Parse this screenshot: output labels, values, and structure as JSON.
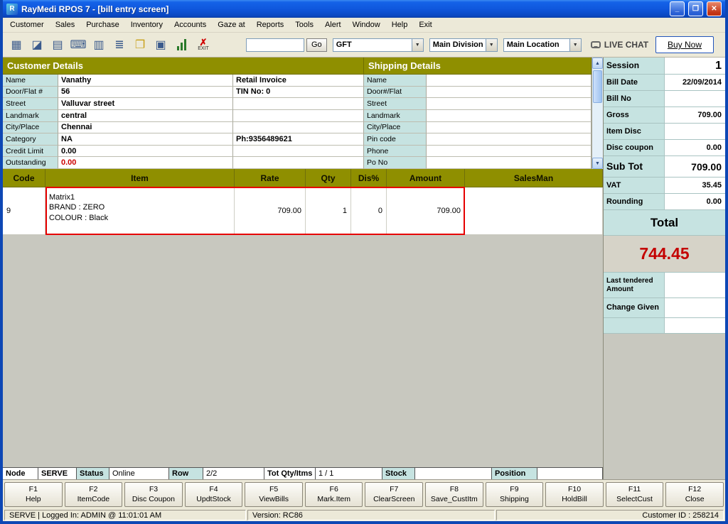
{
  "window": {
    "title": "RayMedi RPOS 7 - [bill entry screen]",
    "app_icon_letter": "R",
    "controls": {
      "minimize": "_",
      "maximize": "❐",
      "close": "✕"
    }
  },
  "menu": {
    "items": [
      "Customer",
      "Sales",
      "Purchase",
      "Inventory",
      "Accounts",
      "Gaze at",
      "Reports",
      "Tools",
      "Alert",
      "Window",
      "Help",
      "Exit"
    ]
  },
  "toolbar": {
    "icons": [
      {
        "name": "bill-icon",
        "glyph": "▦"
      },
      {
        "name": "save-icon",
        "glyph": "◪"
      },
      {
        "name": "print-icon",
        "glyph": "▤"
      },
      {
        "name": "keypad-icon",
        "glyph": "⌨"
      },
      {
        "name": "notes-icon",
        "glyph": "▥"
      },
      {
        "name": "document-icon",
        "glyph": "≣"
      },
      {
        "name": "folder-open-icon",
        "glyph": "❐"
      },
      {
        "name": "display-icon",
        "glyph": "▣"
      }
    ],
    "exit_icon_glyph": "✗",
    "exit_label": "EXIT",
    "search_value": "",
    "go_label": "Go",
    "product_combo_value": "GFT",
    "division_combo_value": "Main Division",
    "location_combo_value": "Main Location",
    "live_chat_label": "LIVE CHAT",
    "buy_now_label": "Buy Now",
    "dropdown_arrow": "▼"
  },
  "customer": {
    "header": "Customer Details",
    "rows": [
      {
        "label": "Name",
        "value": "Vanathy",
        "extra": "Retail Invoice"
      },
      {
        "label": "Door/Flat #",
        "value": "56",
        "extra": "TIN No: 0"
      },
      {
        "label": "Street",
        "value": "Valluvar street",
        "extra": ""
      },
      {
        "label": "Landmark",
        "value": "central",
        "extra": ""
      },
      {
        "label": "City/Place",
        "value": "Chennai",
        "extra": ""
      },
      {
        "label": "Category",
        "value": "NA",
        "extra": "Ph:9356489621"
      },
      {
        "label": "Credit Limit",
        "value": "0.00",
        "extra": ""
      },
      {
        "label": "Outstanding",
        "value": "0.00",
        "extra": ""
      }
    ]
  },
  "shipping": {
    "header": "Shipping Details",
    "rows": [
      {
        "label": "Name",
        "value": ""
      },
      {
        "label": "Door#/Flat",
        "value": ""
      },
      {
        "label": "Street",
        "value": ""
      },
      {
        "label": "Landmark",
        "value": ""
      },
      {
        "label": "City/Place",
        "value": ""
      },
      {
        "label": "Pin code",
        "value": ""
      },
      {
        "label": "Phone",
        "value": ""
      },
      {
        "label": "Po No",
        "value": ""
      }
    ]
  },
  "items_table": {
    "headers": [
      "Code",
      "Item",
      "Rate",
      "Qty",
      "Dis%",
      "Amount",
      "SalesMan"
    ],
    "rows": [
      {
        "code": "9",
        "item": "Matrix1\nBRAND : ZERO\nCOLOUR : Black",
        "rate": "709.00",
        "qty": "1",
        "dis": "0",
        "amount": "709.00",
        "salesman": ""
      }
    ]
  },
  "billing": {
    "rows": [
      {
        "label": "Session",
        "value": "1"
      },
      {
        "label": "Bill Date",
        "value": "22/09/2014"
      },
      {
        "label": "Bill No",
        "value": ""
      },
      {
        "label": "Gross",
        "value": "709.00"
      },
      {
        "label": "Item Disc",
        "value": ""
      },
      {
        "label": "Disc coupon",
        "value": "0.00"
      },
      {
        "label": "Sub Tot",
        "value": "709.00"
      },
      {
        "label": "VAT",
        "value": "35.45"
      },
      {
        "label": "Rounding",
        "value": "0.00"
      }
    ],
    "total_label": "Total",
    "total_value": "744.45",
    "extra_rows": [
      {
        "label": "Last tendered Amount",
        "value": ""
      },
      {
        "label": "Change Given",
        "value": ""
      }
    ]
  },
  "status_row": {
    "cells": [
      "Node",
      "SERVE",
      "Status",
      "Online",
      "Row",
      "2/2",
      "Tot Qty/Itms",
      "1 / 1",
      "Stock",
      "",
      "Position",
      ""
    ]
  },
  "fkeys": [
    {
      "key": "F1",
      "label": "Help"
    },
    {
      "key": "F2",
      "label": "ItemCode"
    },
    {
      "key": "F3",
      "label": "Disc Coupon"
    },
    {
      "key": "F4",
      "label": "UpdtStock"
    },
    {
      "key": "F5",
      "label": "ViewBills"
    },
    {
      "key": "F6",
      "label": "Mark.Item"
    },
    {
      "key": "F7",
      "label": "ClearScreen"
    },
    {
      "key": "F8",
      "label": "Save_CustItm"
    },
    {
      "key": "F9",
      "label": "Shipping"
    },
    {
      "key": "F10",
      "label": "HoldBill"
    },
    {
      "key": "F11",
      "label": "SelectCust"
    },
    {
      "key": "F12",
      "label": "Close"
    }
  ],
  "statusbar": {
    "left": "SERVE | Logged In: ADMIN  @ 11:01:01 AM",
    "center": "Version: RC86",
    "right": "Customer ID : 258214"
  },
  "colors": {
    "titlebar_blue": "#0f57dd",
    "section_olive": "#8f8f00",
    "label_cyan": "#c6e3e1",
    "total_red": "#c40000",
    "highlight_red": "#e60000"
  }
}
